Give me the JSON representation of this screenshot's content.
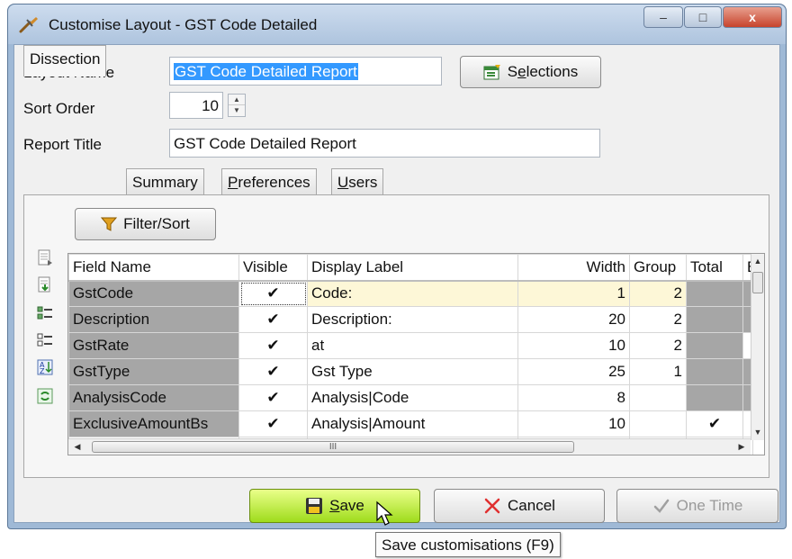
{
  "window": {
    "title": "Customise Layout - GST Code Detailed",
    "minimize_glyph": "–",
    "maximize_glyph": "□",
    "close_glyph": "x"
  },
  "form": {
    "layout_name_label": "Layout Name",
    "layout_name_value": "GST Code Detailed Report",
    "selections_button": {
      "prefix": "S",
      "underlined": "e",
      "suffix": "lections"
    },
    "sort_order_label": "Sort Order",
    "sort_order_value": "10",
    "report_title_label": "Report Title",
    "report_title_value": "GST Code Detailed Report"
  },
  "tabs": [
    {
      "label": "Dissection",
      "underline": "",
      "rest": ""
    },
    {
      "label": "Summary",
      "underline": "",
      "rest": ""
    },
    {
      "label": "",
      "underline": "P",
      "rest": "references"
    },
    {
      "label": "",
      "underline": "U",
      "rest": "sers"
    }
  ],
  "filter_button": "Filter/Sort",
  "grid": {
    "columns": [
      "Field Name",
      "Visible",
      "Display Label",
      "Width",
      "Group",
      "Total",
      "B"
    ],
    "rows": [
      {
        "field": "GstCode",
        "visible": "✔",
        "label": "Code:",
        "width": "1",
        "group": "2",
        "total": ""
      },
      {
        "field": "Description",
        "visible": "✔",
        "label": "Description:",
        "width": "20",
        "group": "2",
        "total": ""
      },
      {
        "field": "GstRate",
        "visible": "✔",
        "label": "at",
        "width": "10",
        "group": "2",
        "total": ""
      },
      {
        "field": "GstType",
        "visible": "✔",
        "label": "Gst Type",
        "width": "25",
        "group": "1",
        "total": ""
      },
      {
        "field": "AnalysisCode",
        "visible": "✔",
        "label": "Analysis|Code",
        "width": "8",
        "group": "",
        "total": ""
      },
      {
        "field": "ExclusiveAmountBs",
        "visible": "✔",
        "label": "Analysis|Amount",
        "width": "10",
        "group": "",
        "total": "✔"
      }
    ],
    "hscroll_grip": "III",
    "scroll_up": "▲",
    "scroll_down": "▼",
    "scroll_left": "◀",
    "scroll_right": "▶"
  },
  "buttons": {
    "save": {
      "underlined": "S",
      "rest": "ave"
    },
    "cancel": "Cancel",
    "one_time": "One Time"
  },
  "tooltip": "Save customisations (F9)",
  "colors": {
    "save_green": "#9fdc1c",
    "cancel_red": "#e03030",
    "selection_blue": "#3399ff",
    "grey_cell": "#a6a6a6",
    "current_row": "#fdf7d7"
  }
}
